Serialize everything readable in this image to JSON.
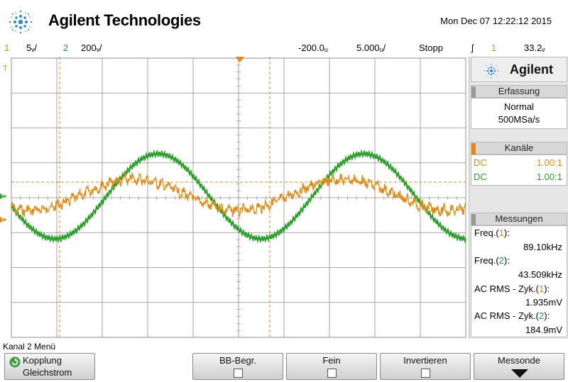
{
  "header": {
    "brand": "Agilent Technologies",
    "datetime": "Mon Dec 07 12:22:12 2015"
  },
  "status": {
    "ch1_num": "1",
    "ch1_scale": "5ᵥ/",
    "ch2_num": "2",
    "ch2_scale": "200ᵥ/",
    "delay": "-200.0ᵤ",
    "timebase": "5.000ᵤ/",
    "run_state": "Stopp",
    "trigger_icon": "ʃ",
    "trigger_ch": "1",
    "trigger_level": "33.2ᵥ"
  },
  "screen_markers": {
    "trigger_T": "T",
    "ch1_marker": "1",
    "ch2_marker": "2"
  },
  "panel": {
    "brand": "Agilent",
    "acquisition": {
      "title": "Erfassung",
      "mode": "Normal",
      "rate": "500MSa/s"
    },
    "channels": {
      "title": "Kanäle",
      "rows": [
        {
          "coupling": "DC",
          "probe": "1.00:1",
          "color": "#e08a10"
        },
        {
          "coupling": "DC",
          "probe": "1.00:1",
          "color": "#2aa02a"
        }
      ]
    },
    "measurements": {
      "title": "Messungen",
      "items": [
        {
          "label_pre": "Freq.(",
          "ch": "1",
          "label_post": "):",
          "value": "89.10kHz",
          "ch_color": "#e08a10"
        },
        {
          "label_pre": "Freq.(",
          "ch": "2",
          "label_post": "):",
          "value": "43.509kHz",
          "ch_color": "#2aa02a"
        },
        {
          "label_pre": "AC RMS - Zyk.(",
          "ch": "1",
          "label_post": "):",
          "value": "1.935mV",
          "ch_color": "#e08a10"
        },
        {
          "label_pre": "AC RMS - Zyk.(",
          "ch": "2",
          "label_post": "):",
          "value": "184.9mV",
          "ch_color": "#2aa02a"
        }
      ]
    }
  },
  "softkeys": {
    "menu_title": "Kanal 2 Menü",
    "kopplung_label": "Kopplung",
    "kopplung_value": "Gleichstrom",
    "bw_label": "BB-Begr.",
    "fine_label": "Fein",
    "invert_label": "Invertieren",
    "probe_label": "Messonde"
  },
  "colors": {
    "ch1": "#e08a10",
    "ch2": "#2aa02a",
    "grid": "#8c8c8c"
  }
}
